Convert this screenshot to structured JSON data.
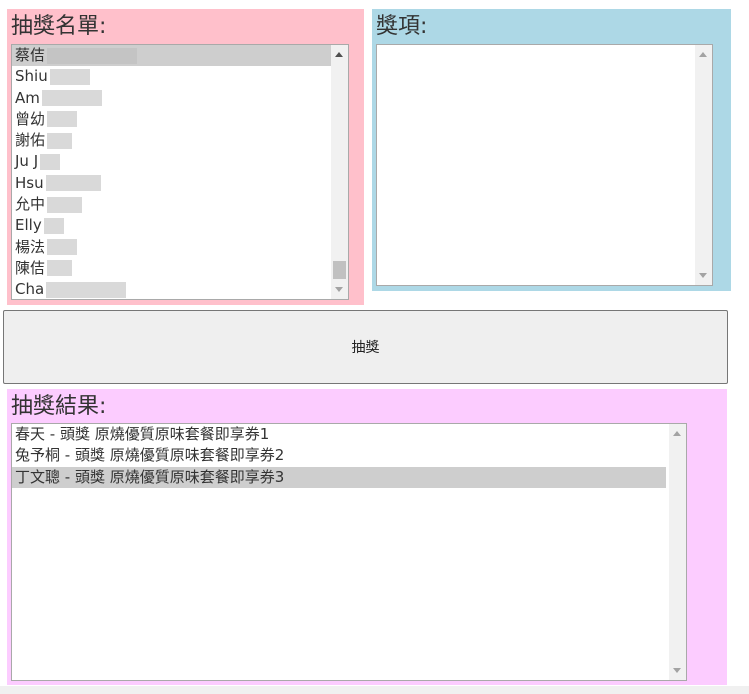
{
  "colors": {
    "entrants_panel_bg": "#ffc0cb",
    "prizes_panel_bg": "#add8e6",
    "results_panel_bg": "#fcccff",
    "selected_row_bg": "#cecece",
    "button_bg": "#efefef"
  },
  "entrants": {
    "title": "抽獎名單:",
    "items": [
      {
        "text": "蔡佶",
        "selected": true
      },
      {
        "text": "Shiu",
        "selected": false
      },
      {
        "text": "Am",
        "selected": false
      },
      {
        "text": "曾幼",
        "selected": false
      },
      {
        "text": "謝佑",
        "selected": false
      },
      {
        "text": "Ju J",
        "selected": false
      },
      {
        "text": "Hsu",
        "selected": false
      },
      {
        "text": "允中",
        "selected": false
      },
      {
        "text": "Elly",
        "selected": false
      },
      {
        "text": "楊法",
        "selected": false
      },
      {
        "text": "陳佶",
        "selected": false
      },
      {
        "text": "Cha",
        "selected": false
      }
    ],
    "note": "names partially pixelated in source"
  },
  "prizes": {
    "title": "獎項:",
    "items": []
  },
  "draw_button": {
    "label": "抽獎"
  },
  "results": {
    "title": "抽獎結果:",
    "items": [
      {
        "text": "春天 - 頭獎 原燒優質原味套餐即享券1",
        "selected": false
      },
      {
        "text": "兔予桐 - 頭獎 原燒優質原味套餐即享券2",
        "selected": false
      },
      {
        "text": "丁文聰 - 頭獎 原燒優質原味套餐即享券3",
        "selected": true
      }
    ]
  }
}
